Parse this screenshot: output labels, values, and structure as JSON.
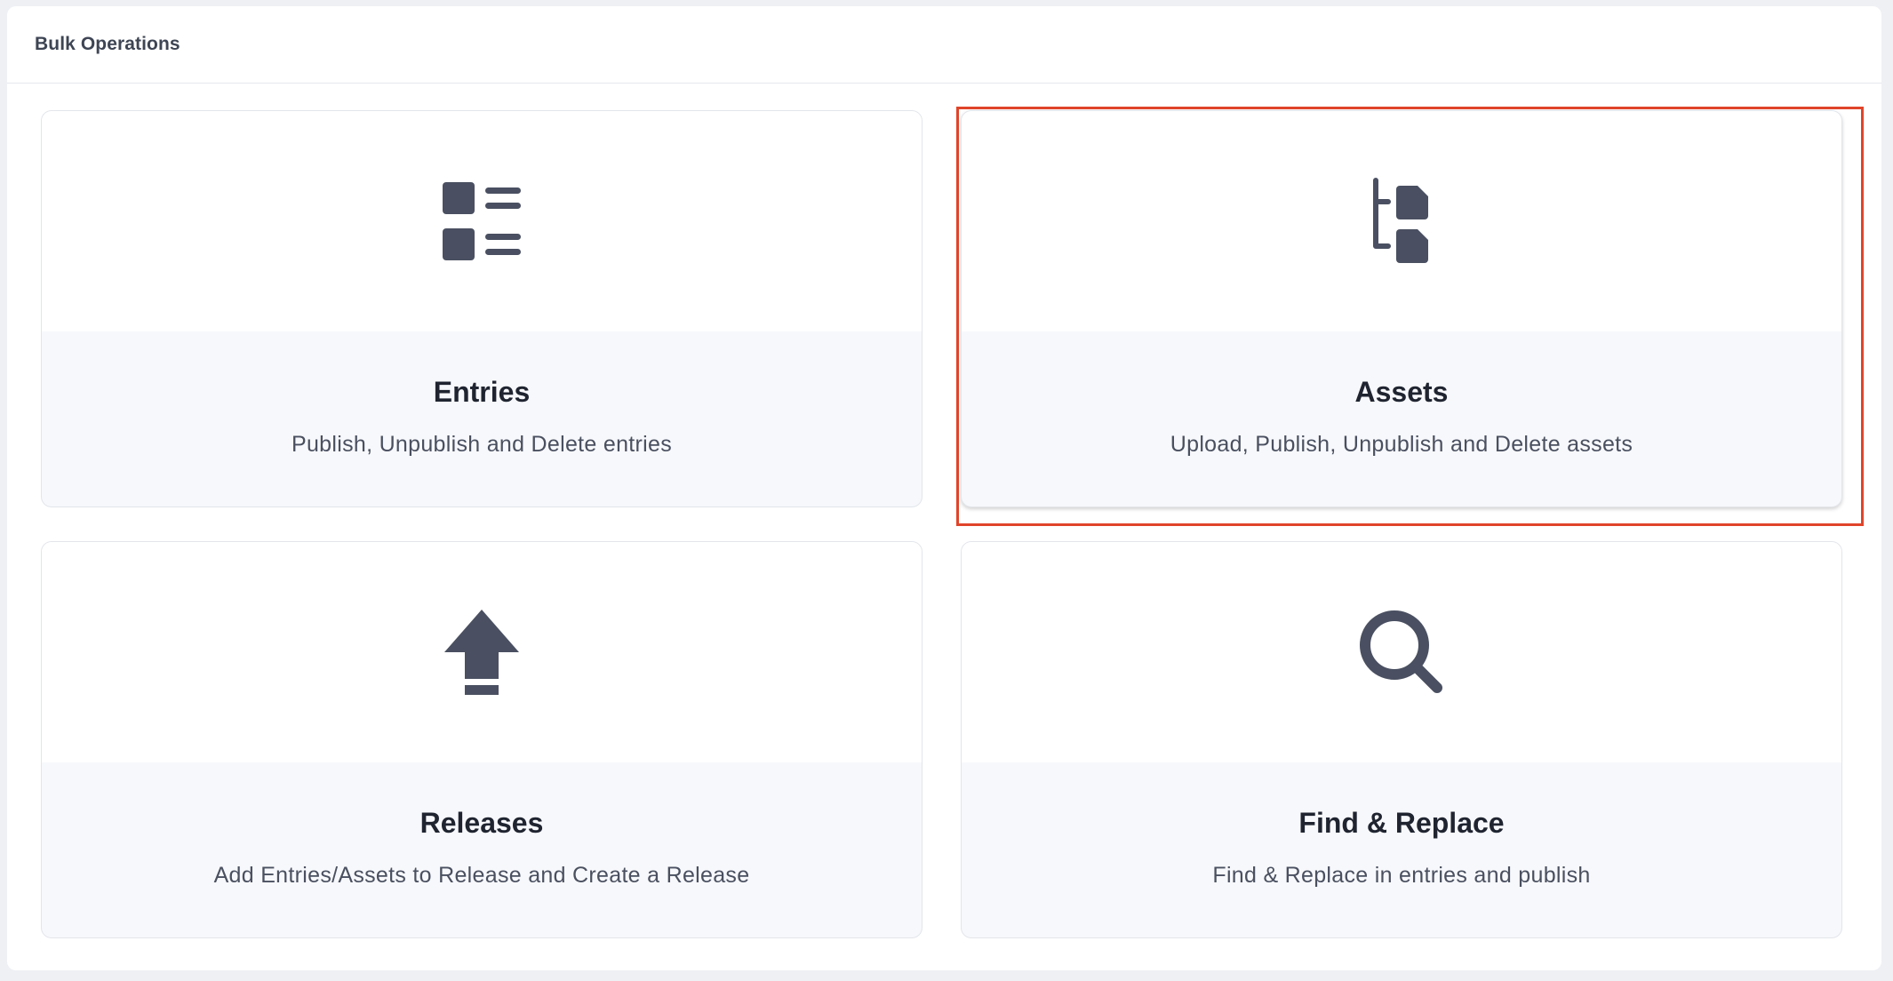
{
  "page": {
    "title": "Bulk Operations"
  },
  "cards": [
    {
      "title": "Entries",
      "description": "Publish, Unpublish and Delete entries",
      "icon": "entries-list-icon"
    },
    {
      "title": "Assets",
      "description": "Upload, Publish, Unpublish and Delete assets",
      "icon": "assets-tree-icon",
      "highlighted": true
    },
    {
      "title": "Releases",
      "description": "Add Entries/Assets to Release and Create a Release",
      "icon": "upload-arrow-icon"
    },
    {
      "title": "Find & Replace",
      "description": "Find & Replace in entries and publish",
      "icon": "search-icon"
    }
  ],
  "colors": {
    "icon": "#4a5061",
    "highlight": "#e0442a"
  }
}
